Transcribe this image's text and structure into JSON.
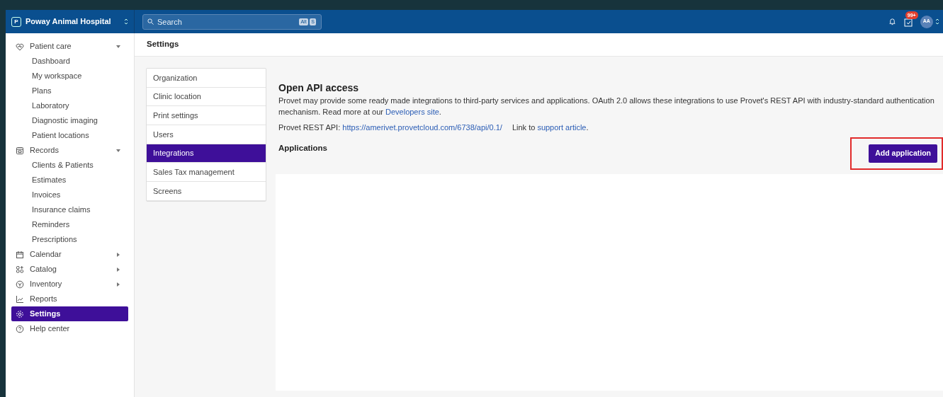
{
  "topbar": {
    "org_initial": "P",
    "org_name": "Poway Animal Hospital",
    "search_placeholder": "Search",
    "shortcut_keys": [
      "Alt",
      "S"
    ],
    "notification_badge": "99+",
    "avatar_initials": "AA"
  },
  "sidebar": {
    "items": [
      {
        "label": "Patient care",
        "kind": "heart",
        "expanded": true,
        "selected": false,
        "children": [
          {
            "label": "Dashboard"
          },
          {
            "label": "My workspace"
          },
          {
            "label": "Plans"
          },
          {
            "label": "Laboratory"
          },
          {
            "label": "Diagnostic imaging"
          },
          {
            "label": "Patient locations"
          }
        ]
      },
      {
        "label": "Records",
        "kind": "records",
        "expanded": true,
        "selected": false,
        "children": [
          {
            "label": "Clients & Patients"
          },
          {
            "label": "Estimates"
          },
          {
            "label": "Invoices"
          },
          {
            "label": "Insurance claims"
          },
          {
            "label": "Reminders"
          },
          {
            "label": "Prescriptions"
          }
        ]
      },
      {
        "label": "Calendar",
        "kind": "calendar",
        "expanded": false,
        "selected": false
      },
      {
        "label": "Catalog",
        "kind": "catalog",
        "expanded": false,
        "selected": false
      },
      {
        "label": "Inventory",
        "kind": "box",
        "expanded": false,
        "selected": false
      },
      {
        "label": "Reports",
        "kind": "chart",
        "selected": false
      },
      {
        "label": "Settings",
        "kind": "gear",
        "selected": true
      },
      {
        "label": "Help center",
        "kind": "help",
        "selected": false
      }
    ]
  },
  "page_title": "Settings",
  "settings_menu": [
    {
      "label": "Organization",
      "selected": false
    },
    {
      "label": "Clinic location",
      "selected": false
    },
    {
      "label": "Print settings",
      "selected": false
    },
    {
      "label": "Users",
      "selected": false
    },
    {
      "label": "Integrations",
      "selected": true
    },
    {
      "label": "Sales Tax management",
      "selected": false
    },
    {
      "label": "Screens",
      "selected": false
    }
  ],
  "content": {
    "heading": "Open API access",
    "description": "Provet may provide some ready made integrations to third-party services and applications. OAuth 2.0 allows these integrations to use Provet's REST API with industry-standard authentication mechanism. Read more at our ",
    "description_link": "Developers site",
    "description_end": ".",
    "api_label": "Provet REST API: ",
    "api_url": "https://amerivet.provetcloud.com/6738/api/0.1/",
    "link_prefix": "Link to ",
    "link_text": "support article",
    "link_end": ".",
    "applications_title": "Applications",
    "add_button": "Add application",
    "add_button_highlighted": true
  }
}
